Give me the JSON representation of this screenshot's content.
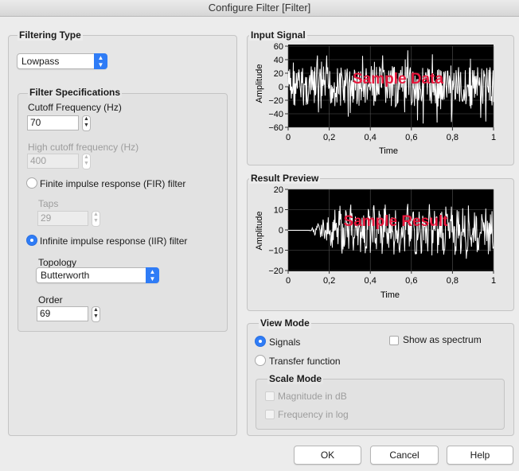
{
  "window": {
    "title": "Configure Filter [Filter]"
  },
  "filtering_type": {
    "label": "Filtering Type",
    "selected": "Lowpass"
  },
  "filter_specs": {
    "label": "Filter Specifications",
    "cutoff_label": "Cutoff Frequency (Hz)",
    "cutoff_value": "70",
    "high_cutoff_label": "High cutoff frequency (Hz)",
    "high_cutoff_value": "400",
    "fir_label": "Finite impulse response (FIR) filter",
    "fir_selected": false,
    "taps_label": "Taps",
    "taps_value": "29",
    "iir_label": "Infinite impulse response (IIR) filter",
    "iir_selected": true,
    "topology_label": "Topology",
    "topology_value": "Butterworth",
    "order_label": "Order",
    "order_value": "69"
  },
  "input_signal": {
    "label": "Input Signal",
    "ylabel": "Amplitude",
    "xlabel": "Time",
    "overlay": "Sample Data",
    "yticks": [
      "60",
      "40",
      "20",
      "0",
      "−20",
      "−40",
      "−60"
    ],
    "xticks": [
      "0",
      "0,2",
      "0,4",
      "0,6",
      "0,8",
      "1"
    ]
  },
  "result_preview": {
    "label": "Result Preview",
    "ylabel": "Amplitude",
    "xlabel": "Time",
    "overlay": "Sample Result",
    "yticks": [
      "20",
      "10",
      "0",
      "−10",
      "−20"
    ],
    "xticks": [
      "0",
      "0,2",
      "0,4",
      "0,6",
      "0,8",
      "1"
    ]
  },
  "view_mode": {
    "label": "View Mode",
    "signals_label": "Signals",
    "signals_selected": true,
    "transfer_label": "Transfer function",
    "spectrum_label": "Show as spectrum",
    "scale_mode_label": "Scale Mode",
    "magnitude_db_label": "Magnitude in dB",
    "freq_log_label": "Frequency in log"
  },
  "buttons": {
    "ok": "OK",
    "cancel": "Cancel",
    "help": "Help"
  },
  "colors": {
    "accent": "#2f7cf6",
    "overlay_text": "#e8173c",
    "plot_bg": "#000000",
    "trace": "#ffffff"
  }
}
